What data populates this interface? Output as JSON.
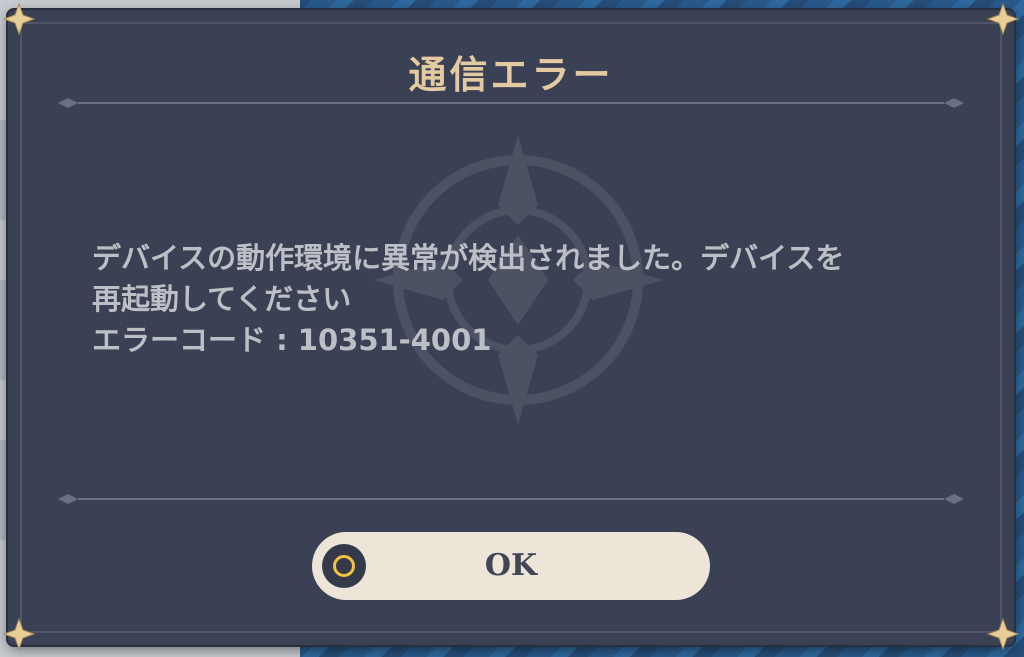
{
  "dialog": {
    "title": "通信エラー",
    "message_lines": [
      "デバイスの動作環境に異常が検出されました。デバイスを",
      "再起動してください",
      "エラーコード : 10351-4001"
    ],
    "ok_label": "OK"
  },
  "colors": {
    "dialog_background": "#3b4154",
    "title": "#e4caa0",
    "message": "#bdbfc6",
    "button_background": "#ece5d8",
    "button_text": "#404656",
    "button_icon_ring": "#f3c241"
  },
  "icons": {
    "corner": "gold-star-corner-icon",
    "confirm": "circle-button-icon",
    "emblem": "emblem-watermark-icon"
  }
}
